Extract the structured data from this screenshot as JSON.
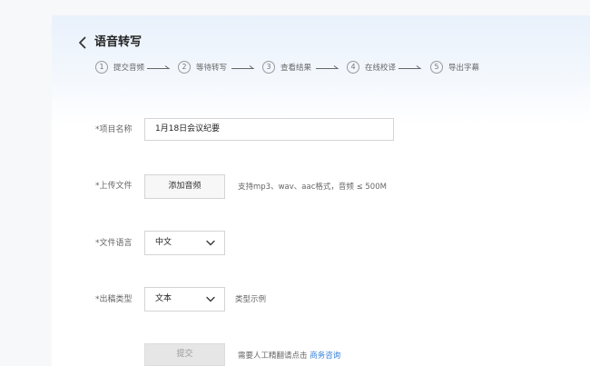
{
  "header": {
    "title": "语音转写"
  },
  "steps": [
    {
      "num": "1",
      "label": "提交音频"
    },
    {
      "num": "2",
      "label": "等待转写"
    },
    {
      "num": "3",
      "label": "查看结果"
    },
    {
      "num": "4",
      "label": "在线校译"
    },
    {
      "num": "5",
      "label": "导出字幕"
    }
  ],
  "form": {
    "project_name": {
      "label": "*项目名称",
      "value": "1月18日会议纪要"
    },
    "upload": {
      "label": "*上传文件",
      "button": "添加音频",
      "hint": "支持mp3、wav、aac格式，音频 ≤ 500M"
    },
    "language": {
      "label": "*文件语言",
      "value": "中文"
    },
    "output_type": {
      "label": "*出稿类型",
      "value": "文本",
      "hint": "类型示例"
    },
    "submit": {
      "label": "提交",
      "hint": "需要人工精翻请点击",
      "link": "商务咨询"
    }
  },
  "icons": {
    "back": "chevron-left-icon",
    "select_arrow": "chevron-down-icon",
    "step_arrow": "arrow-right-icon"
  },
  "colors": {
    "link": "#2f7bd8",
    "header_gradient": "#e9f1fc"
  }
}
